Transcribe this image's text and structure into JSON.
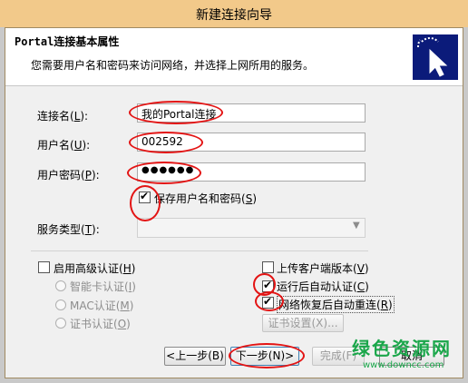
{
  "window": {
    "title": "新建连接向导"
  },
  "header": {
    "title": "Portal连接基本属性",
    "subtitle": "您需要用户名和密码来访问网络，并选择上网所用的服务。",
    "logo_icon": "cursor-click-icon"
  },
  "form": {
    "conn_name": {
      "label_pre": "连接名(",
      "key": "L",
      "label_post": "):",
      "value": "我的Portal连接"
    },
    "user_name": {
      "label_pre": "用户名(",
      "key": "U",
      "label_post": "):",
      "value": "002592"
    },
    "password": {
      "label_pre": "用户密码(",
      "key": "P",
      "label_post": "):",
      "value": "●●●●●●"
    },
    "save_cred": {
      "label_pre": "保存用户名和密码(",
      "key": "S",
      "label_post": ")",
      "checked": true
    },
    "service": {
      "label_pre": "服务类型(",
      "key": "T",
      "label_post": "):",
      "value": ""
    }
  },
  "advanced": {
    "enable": {
      "label_pre": "启用高级认证(",
      "key": "H",
      "label_post": ")",
      "checked": false
    },
    "smartcard": {
      "label_pre": "智能卡认证(",
      "key": "I",
      "label_post": ")"
    },
    "mac": {
      "label_pre": "MAC认证(",
      "key": "M",
      "label_post": ")"
    },
    "cert": {
      "label_pre": "证书认证(",
      "key": "O",
      "label_post": ")"
    }
  },
  "options": {
    "upload_version": {
      "label_pre": "上传客户端版本(",
      "key": "V",
      "label_post": ")",
      "checked": false
    },
    "auto_auth": {
      "label_pre": "运行后自动认证(",
      "key": "C",
      "label_post": ")",
      "checked": true
    },
    "auto_reconnect": {
      "label_pre": "网络恢复后自动重连(",
      "key": "R",
      "label_post": ")",
      "checked": true
    },
    "cert_settings": "证书设置(X)..."
  },
  "buttons": {
    "back": "<上一步(B)",
    "next": "下一步(N)>",
    "finish": "完成(F)",
    "cancel": "取消"
  },
  "watermark": {
    "line1": "绿色资源网",
    "line2": "www.downcc.com"
  },
  "colors": {
    "titlebar": "#f2c98a",
    "highlight": "#e31414",
    "logo_bg": "#0b1b7a"
  }
}
